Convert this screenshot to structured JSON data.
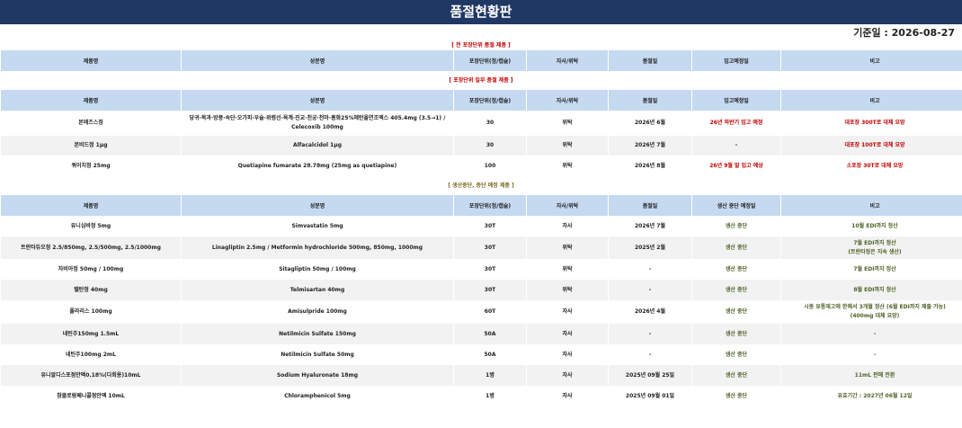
{
  "title": "품절현황판",
  "date_label": "기준일 : 2026-08-27",
  "sections": {
    "full": {
      "label": "[ 전 포장단위 품절 제품 ]",
      "headers": [
        "제품명",
        "성분명",
        "포장단위(정/캡슐)",
        "자사/위탁",
        "품절일",
        "입고예정일",
        "비고"
      ]
    },
    "partial": {
      "label": "[ 포장단위 일부 품절 제품 ]",
      "headers": [
        "제품명",
        "성분명",
        "포장단위(정/캡슐)",
        "자사/위탁",
        "품절일",
        "입고예정일",
        "비고"
      ],
      "rows": [
        [
          "본에즈스정",
          "당귀·목과·방풍·속단·오가피·우슬·위령선·육계·진교·천궁·천마·홍화25%에탄올연조엑스 405.4mg (3.5→1) /  Celecoxib 100mg",
          "30",
          "위탁",
          "2026년 6월",
          "26년 하반기 입고 예정",
          "대포장 300T로 대체 요망"
        ],
        [
          "본비드정 1μg",
          "Alfacalcidol 1μg",
          "30",
          "위탁",
          "2026년 7월",
          "-",
          "대포장 100T로 대체 요망"
        ],
        [
          "쿼이치정 25mg",
          "Quetiapine fumarate 28.78mg (25mg as quetiapine)",
          "100",
          "위탁",
          "2026년 8월",
          "26년 9월 말 입고 예상",
          "소포장 30T로 대체 요망"
        ]
      ]
    },
    "discontinued": {
      "label": "[ 생산중단, 중단 예정 제품 ]",
      "headers": [
        "제품명",
        "성분명",
        "포장단위(정/캡슐)",
        "자사/위탁",
        "품절일",
        "생산 중단 예정일",
        "비고"
      ],
      "rows": [
        [
          "유니심바정 5mg",
          "Simvastatin 5mg",
          "30T",
          "자사",
          "2026년 7월",
          "생산 중단",
          "10월 EDI까지 정산"
        ],
        [
          "트란타듀오정 2.5/850mg, 2.5/500mg, 2.5/1000mg",
          "Linagliptin 2.5mg / Metformin hydrochloride 500mg, 850mg, 1000mg",
          "30T",
          "위탁",
          "2025년 2월",
          "생산 중단",
          "7월 EDI까지 정산\n(트란타정은 지속 생산)"
        ],
        [
          "자비아정 50mg / 100mg",
          "Sitagliptin 50mg / 100mg",
          "30T",
          "위탁",
          "-",
          "생산 중단",
          "7월 EDI까지 정산"
        ],
        [
          "텔탄정 40mg",
          "Telmisartan 40mg",
          "30T",
          "위탁",
          "-",
          "생산 중단",
          "8월 EDI까지 정산"
        ],
        [
          "폴라리스 100mg",
          "Amisulpride 100mg",
          "60T",
          "자사",
          "2026년 4월",
          "생산 중단",
          "시중 유통재고에 한해서 3개월 정산 (6월 EDI까지 제출 가능)\n(400mg 대체 요망)"
        ],
        [
          "네틴주150mg 1.5mL",
          "Netilmicin Sulfate 150mg",
          "50A",
          "자사",
          "-",
          "생산 중단",
          "-"
        ],
        [
          "네틴주100mg 2mL",
          "Netilmicin Sulfate 50mg",
          "50A",
          "자사",
          "-",
          "생산 중단",
          "-"
        ],
        [
          "유니알디스포점안액0.18%(다회용)10mL",
          "Sodium Hyaluronate 18mg",
          "1병",
          "자사",
          "2025년 09월 25일",
          "생산 중단",
          "11mL 판매 전환"
        ],
        [
          "참클로람페니콜점안액 10mL",
          "Chloramphenicol 5mg",
          "1병",
          "자사",
          "2025년 09월 01일",
          "생산 중단",
          "유효기간 : 2027년 06월 12일"
        ]
      ]
    }
  },
  "colors": {
    "banner": "#1f3864",
    "header_bg": "#c5d9f1",
    "red": "#c00000",
    "olive": "#4f6228"
  }
}
